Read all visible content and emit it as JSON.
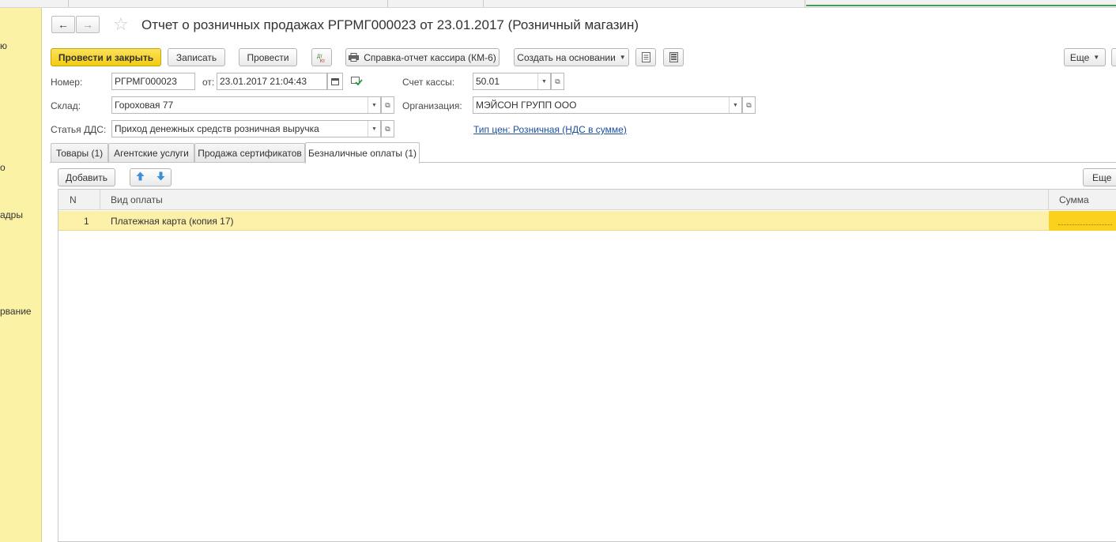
{
  "left_panel": {
    "items": [
      "ю",
      "о",
      "адры",
      "рвание"
    ]
  },
  "window": {
    "title": "Отчет о розничных продажах РГРМГ000023 от 23.01.2017 (Розничный магазин)",
    "back_icon": "arrow-left-icon",
    "forward_icon": "arrow-right-icon",
    "favorite_icon": "star-icon"
  },
  "toolbar": {
    "post_close_label": "Провести и закрыть",
    "save_label": "Записать",
    "post_label": "Провести",
    "dtkt_label": "Дт Кт",
    "cashier_report_label": "Справка-отчет кассира (КМ-6)",
    "create_based_label": "Создать на основании",
    "more_label": "Еще"
  },
  "form": {
    "number_label": "Номер:",
    "number_value": "РГРМГ000023",
    "date_label": "от:",
    "date_value": "23.01.2017 21:04:43",
    "cash_account_label": "Счет кассы:",
    "cash_account_value": "50.01",
    "warehouse_label": "Склад:",
    "warehouse_value": "Гороховая 77",
    "organization_label": "Организация:",
    "organization_value": "МЭЙСОН ГРУПП ООО",
    "dds_label": "Статья ДДС:",
    "dds_value": "Приход денежных средств розничная выручка",
    "price_type_link": "Тип цен: Розничная (НДС в сумме)"
  },
  "tabs": [
    {
      "label": "Товары (1)",
      "active": false
    },
    {
      "label": "Агентские услуги",
      "active": false
    },
    {
      "label": "Продажа сертификатов",
      "active": false
    },
    {
      "label": "Безналичные оплаты (1)",
      "active": true
    }
  ],
  "table_toolbar": {
    "add_label": "Добавить",
    "more_label": "Еще"
  },
  "table": {
    "columns": [
      "N",
      "Вид оплаты",
      "Сумма"
    ],
    "rows": [
      {
        "n": "1",
        "payment_type": "Платежная карта (копия 17)",
        "amount": ""
      }
    ]
  },
  "colors": {
    "primary_button": "#f2cc12",
    "left_panel": "#fbf2a6",
    "selected_row": "#fdf0a8",
    "active_cell": "#fbd11d",
    "link": "#1a4fa0"
  }
}
